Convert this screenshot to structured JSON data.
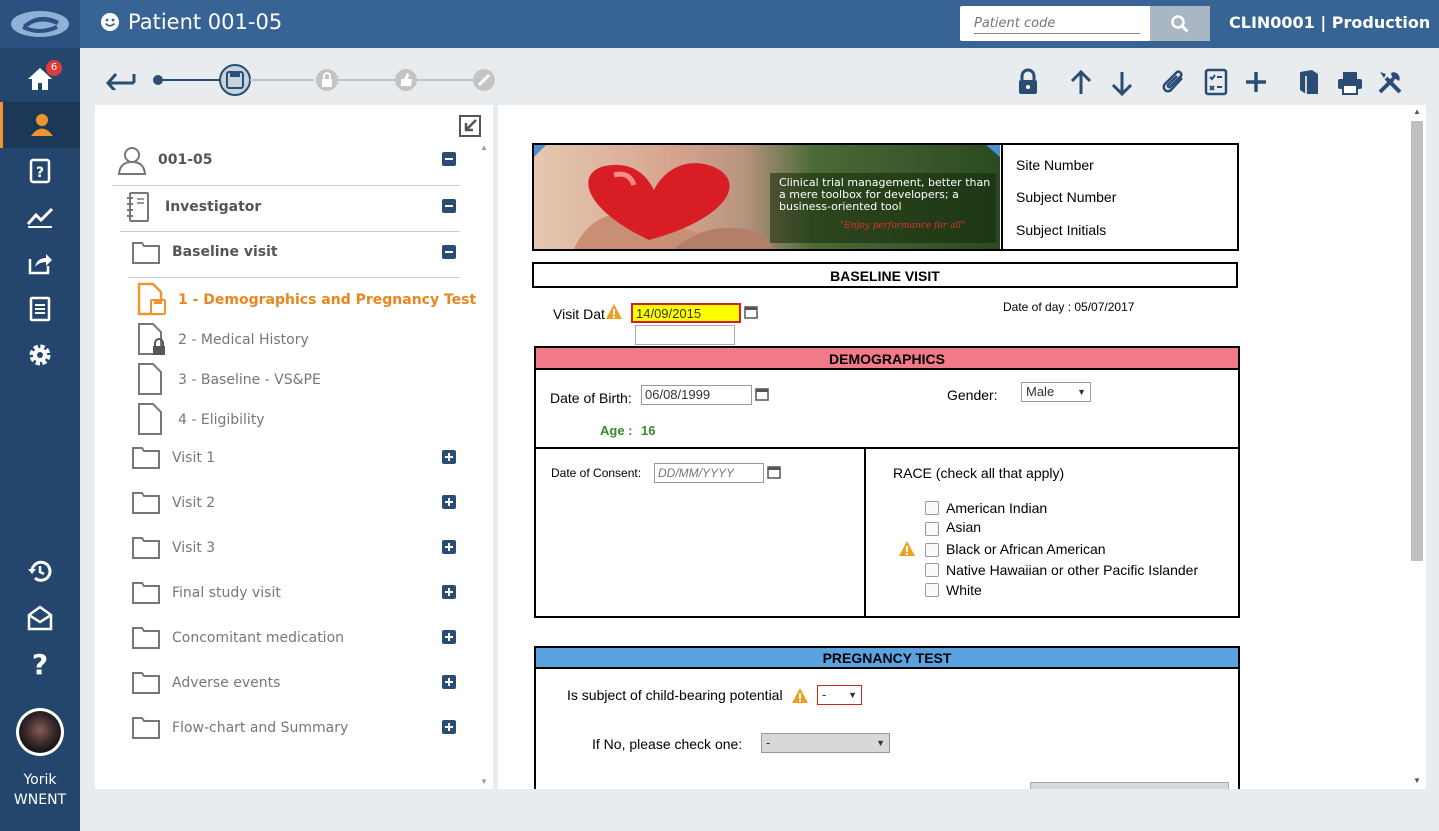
{
  "app": {
    "notification_count": "6"
  },
  "header": {
    "title": "Patient 001-05",
    "search_placeholder": "Patient code",
    "environment": "CLIN0001 | Production"
  },
  "user": {
    "first_name": "Yorik",
    "last_name": "WNENT"
  },
  "tree": {
    "patient": "001-05",
    "role": "Investigator",
    "visit": "Baseline visit",
    "forms": [
      "1 - Demographics and Pregnancy Test",
      "2 - Medical History",
      "3 - Baseline - VS&PE",
      "4 - Eligibility"
    ],
    "folders": [
      "Visit 1",
      "Visit 2",
      "Visit 3",
      "Final study visit",
      "Concomitant medication",
      "Adverse events",
      "Flow-chart and Summary"
    ]
  },
  "form": {
    "banner_text": "Clinical trial management, better than a mere toolbox for developers; a business-oriented tool",
    "banner_slogan": "\"Enjoy performance for all\"",
    "site_number": "Site Number",
    "subject_number": "Subject Number",
    "subject_initials": "Subject Initials",
    "section_title": "BASELINE VISIT",
    "visit_date_label": "Visit Dat",
    "visit_date_value": "14/09/2015",
    "date_of_day": "Date of day : 05/07/2017",
    "demographics": {
      "title": "DEMOGRAPHICS",
      "dob_label": "Date of Birth:",
      "dob_value": "06/08/1999",
      "gender_label": "Gender:",
      "gender_value": "Male",
      "age_label": "Age :",
      "age_value": "16",
      "consent_label": "Date of Consent:",
      "consent_placeholder": "DD/MM/YYYY",
      "race_label": "RACE (check all that apply)",
      "race_options": [
        "American Indian",
        "Asian",
        "Black or African American",
        "Native Hawaiian or other Pacific Islander",
        "White"
      ]
    },
    "pregnancy": {
      "title": "PREGNANCY TEST",
      "potential_label": "Is subject of child-bearing potential",
      "potential_value": "-",
      "if_no_label": "If No, please check one:",
      "if_no_value": "-"
    }
  },
  "colors": {
    "sidebar": "#24466d",
    "topbar": "#376494",
    "accent": "#f0942f",
    "demographics_header": "#f07a87",
    "pregnancy_header": "#5aa3e0",
    "age_green": "#3a8a2a",
    "highlight": "#ffff00"
  }
}
